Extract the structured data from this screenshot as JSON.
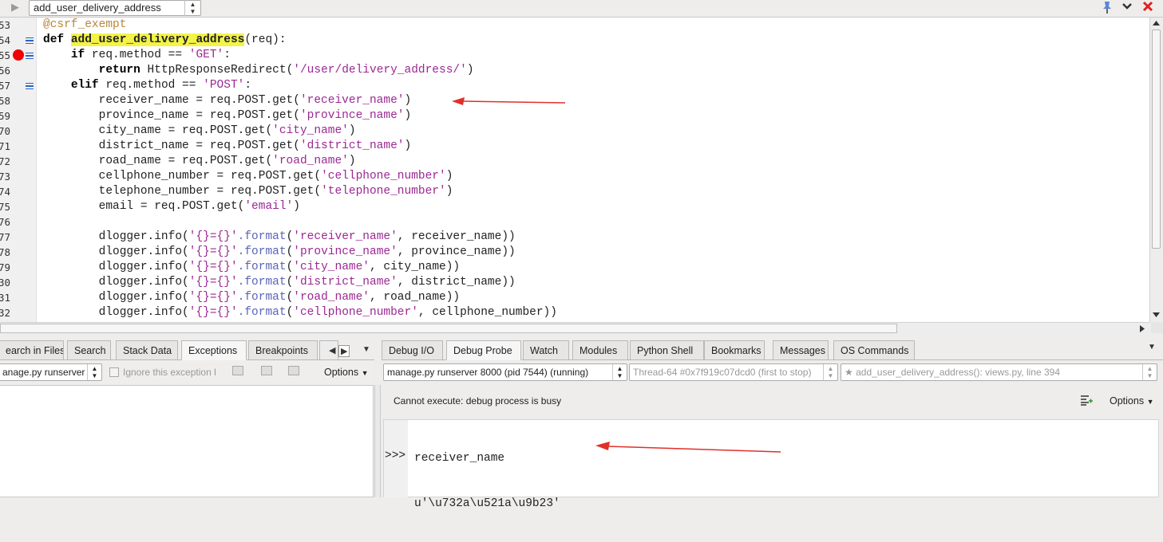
{
  "toolbar": {
    "run_icon": "play-icon",
    "file_selector": "add_user_delivery_address",
    "icons": [
      "pin-icon",
      "chevron-down-icon",
      "close-icon"
    ]
  },
  "editor": {
    "lines": [
      {
        "n": "53",
        "s": [
          {
            "t": "@csrf_exempt",
            "c": "dec"
          }
        ]
      },
      {
        "n": "54",
        "s": [
          {
            "t": "def ",
            "c": "kw"
          },
          {
            "t": "add_user_delivery_address",
            "c": "hl"
          },
          {
            "t": "(req):"
          }
        ]
      },
      {
        "n": "55",
        "s": [
          {
            "t": "    "
          },
          {
            "t": "if",
            "c": "kw"
          },
          {
            "t": " req.method == "
          },
          {
            "t": "'GET'",
            "c": "str"
          },
          {
            "t": ":"
          }
        ]
      },
      {
        "n": "56",
        "s": [
          {
            "t": "        "
          },
          {
            "t": "return",
            "c": "kw"
          },
          {
            "t": " HttpResponseRedirect("
          },
          {
            "t": "'/user/delivery_address/'",
            "c": "str"
          },
          {
            "t": ")"
          }
        ]
      },
      {
        "n": "57",
        "s": [
          {
            "t": "    "
          },
          {
            "t": "elif",
            "c": "kw"
          },
          {
            "t": " req.method == "
          },
          {
            "t": "'POST'",
            "c": "str"
          },
          {
            "t": ":"
          }
        ]
      },
      {
        "n": "58",
        "s": [
          {
            "t": "        receiver_name = req.POST.get("
          },
          {
            "t": "'receiver_name'",
            "c": "str"
          },
          {
            "t": ")"
          }
        ]
      },
      {
        "n": "59",
        "s": [
          {
            "t": "        province_name = req.POST.get("
          },
          {
            "t": "'province_name'",
            "c": "str"
          },
          {
            "t": ")"
          }
        ]
      },
      {
        "n": "70",
        "s": [
          {
            "t": "        city_name = req.POST.get("
          },
          {
            "t": "'city_name'",
            "c": "str"
          },
          {
            "t": ")"
          }
        ]
      },
      {
        "n": "71",
        "s": [
          {
            "t": "        district_name = req.POST.get("
          },
          {
            "t": "'district_name'",
            "c": "str"
          },
          {
            "t": ")"
          }
        ]
      },
      {
        "n": "72",
        "s": [
          {
            "t": "        road_name = req.POST.get("
          },
          {
            "t": "'road_name'",
            "c": "str"
          },
          {
            "t": ")"
          }
        ]
      },
      {
        "n": "73",
        "s": [
          {
            "t": "        cellphone_number = req.POST.get("
          },
          {
            "t": "'cellphone_number'",
            "c": "str"
          },
          {
            "t": ")"
          }
        ]
      },
      {
        "n": "74",
        "s": [
          {
            "t": "        telephone_number = req.POST.get("
          },
          {
            "t": "'telephone_number'",
            "c": "str"
          },
          {
            "t": ")"
          }
        ]
      },
      {
        "n": "75",
        "s": [
          {
            "t": "        email = req.POST.get("
          },
          {
            "t": "'email'",
            "c": "str"
          },
          {
            "t": ")"
          }
        ]
      },
      {
        "n": "76",
        "s": [
          {
            "t": ""
          }
        ]
      },
      {
        "n": "77",
        "s": [
          {
            "t": "        dlogger.info("
          },
          {
            "t": "'{}={}'",
            "c": "str"
          },
          {
            "t": ".format",
            "c": "fmt"
          },
          {
            "t": "("
          },
          {
            "t": "'receiver_name'",
            "c": "str"
          },
          {
            "t": ", receiver_name))"
          }
        ]
      },
      {
        "n": "78",
        "s": [
          {
            "t": "        dlogger.info("
          },
          {
            "t": "'{}={}'",
            "c": "str"
          },
          {
            "t": ".format",
            "c": "fmt"
          },
          {
            "t": "("
          },
          {
            "t": "'province_name'",
            "c": "str"
          },
          {
            "t": ", province_name))"
          }
        ]
      },
      {
        "n": "79",
        "s": [
          {
            "t": "        dlogger.info("
          },
          {
            "t": "'{}={}'",
            "c": "str"
          },
          {
            "t": ".format",
            "c": "fmt"
          },
          {
            "t": "("
          },
          {
            "t": "'city_name'",
            "c": "str"
          },
          {
            "t": ", city_name))"
          }
        ]
      },
      {
        "n": "30",
        "s": [
          {
            "t": "        dlogger.info("
          },
          {
            "t": "'{}={}'",
            "c": "str"
          },
          {
            "t": ".format",
            "c": "fmt"
          },
          {
            "t": "("
          },
          {
            "t": "'district_name'",
            "c": "str"
          },
          {
            "t": ", district_name))"
          }
        ]
      },
      {
        "n": "31",
        "s": [
          {
            "t": "        dlogger.info("
          },
          {
            "t": "'{}={}'",
            "c": "str"
          },
          {
            "t": ".format",
            "c": "fmt"
          },
          {
            "t": "("
          },
          {
            "t": "'road_name'",
            "c": "str"
          },
          {
            "t": ", road_name))"
          }
        ]
      },
      {
        "n": "32",
        "s": [
          {
            "t": "        dlogger.info("
          },
          {
            "t": "'{}={}'",
            "c": "str"
          },
          {
            "t": ".format",
            "c": "fmt"
          },
          {
            "t": "("
          },
          {
            "t": "'cellphone_number'",
            "c": "str"
          },
          {
            "t": ", cellphone_number))"
          }
        ]
      }
    ]
  },
  "left_panel": {
    "tabs": [
      "earch in Files",
      "Search",
      "Stack Data",
      "Exceptions",
      "Breakpoints"
    ],
    "active_tab": "Exceptions",
    "process_selector": "anage.py runserver",
    "ignore_label": "Ignore this exception l",
    "options_label": "Options"
  },
  "right_panel": {
    "tabs": [
      "Debug I/O",
      "Debug Probe",
      "Watch",
      "Modules",
      "Python Shell",
      "Bookmarks",
      "Messages",
      "OS Commands"
    ],
    "active_tab": "Debug Probe",
    "process_selector": "manage.py runserver 8000 (pid 7544) (running)",
    "thread_selector": "Thread-64 #0x7f919c07dcd0 (first to stop)",
    "frame_selector": "★ add_user_delivery_address(): views.py, line 394",
    "status_message": "Cannot execute: debug process is busy",
    "options_label": "Options",
    "console_lines": [
      "receiver_name",
      "u'\\u732a\\u521a\\u9b23'"
    ],
    "prompt": ">>>"
  },
  "annotation_color": "#e0302a"
}
